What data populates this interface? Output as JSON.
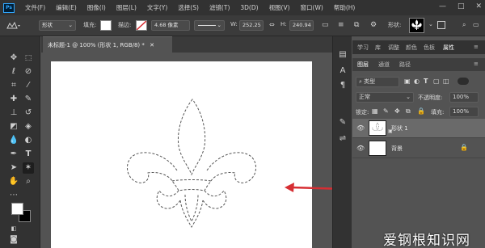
{
  "app": {
    "logo": "Ps"
  },
  "menu": [
    "文件(F)",
    "编辑(E)",
    "图像(I)",
    "图层(L)",
    "文字(Y)",
    "选择(S)",
    "滤镜(T)",
    "3D(D)",
    "视图(V)",
    "窗口(W)",
    "帮助(H)"
  ],
  "window_controls": {
    "minimize": "—",
    "maximize": "□",
    "close": "✕"
  },
  "options": {
    "mode": "形状",
    "fill_label": "填充:",
    "stroke_label": "描边:",
    "stroke_size": "4.68 像素",
    "w_label": "W:",
    "w_value": "252.25",
    "h_label": "H:",
    "h_value": "240.94",
    "shape_label": "形状:"
  },
  "document": {
    "tab_title": "未标题-1 @ 100% (形状 1, RGB/8) *",
    "close": "✕"
  },
  "right_tabs": [
    "学习",
    "库",
    "调整",
    "颜色",
    "色板",
    "属性"
  ],
  "layers_tabs": [
    "图层",
    "通道",
    "路径"
  ],
  "layers": {
    "filter_label": "类型",
    "blend_mode": "正常",
    "opacity_label": "不透明度:",
    "opacity_value": "100%",
    "lock_label": "锁定:",
    "fill_label": "填充:",
    "fill_value": "100%",
    "items": [
      {
        "name": "形状 1",
        "selected": true
      },
      {
        "name": "背景",
        "selected": false
      }
    ]
  },
  "watermark": "爱钢根知识网",
  "colors": {
    "arrow": "#d62e33",
    "accent": "#31a8ff"
  }
}
